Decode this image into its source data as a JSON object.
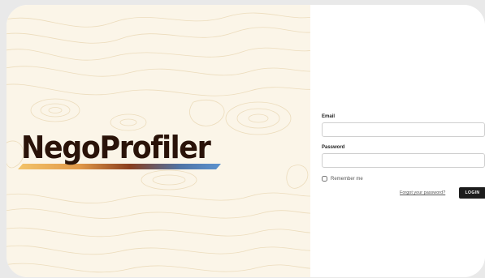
{
  "brand": {
    "name": "NegoProfiler",
    "underline_colors": [
      "#f3c46a",
      "#e29a4a",
      "#8a3e1e",
      "#4f74a6",
      "#5d93cf"
    ],
    "text_color": "#2a1309"
  },
  "background": {
    "panel_color": "#fbf5e8",
    "topo_line_color": "#ecdcbc"
  },
  "login_form": {
    "email_label": "Email",
    "email_value": "",
    "password_label": "Password",
    "password_value": "",
    "remember_label": "Remember me",
    "remember_checked": false,
    "forgot_label": "Forgot your password?",
    "login_label": "LOGIN"
  }
}
